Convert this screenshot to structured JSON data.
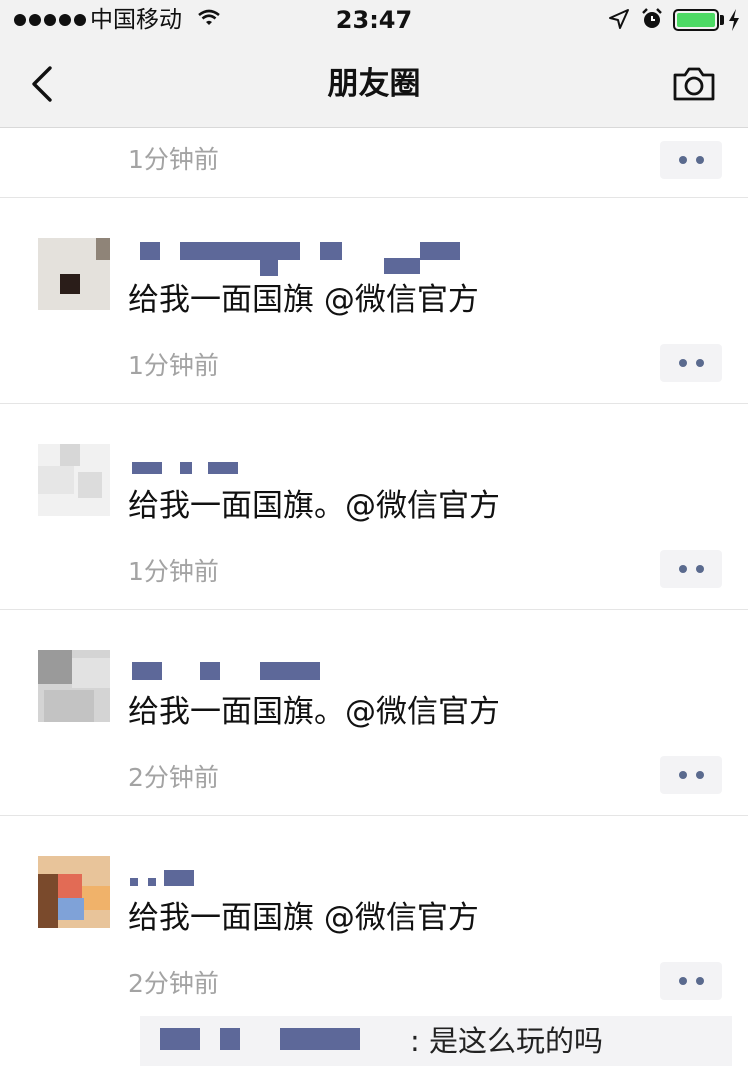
{
  "status_bar": {
    "carrier": "中国移动",
    "time": "23:47",
    "battery_level": 1.0,
    "icons": [
      "signal-dots-icon",
      "wifi-icon",
      "location-arrow-icon",
      "alarm-icon",
      "battery-icon",
      "charging-bolt-icon"
    ]
  },
  "nav": {
    "title": "朋友圈",
    "back_icon": "chevron-left-icon",
    "camera_icon": "camera-icon"
  },
  "feed": {
    "partial_row": {
      "time": "1分钟前"
    },
    "posts": [
      {
        "text": "给我一面国旗 @微信官方",
        "time": "1分钟前"
      },
      {
        "text": "给我一面国旗。@微信官方",
        "time": "1分钟前"
      },
      {
        "text": "给我一面国旗。@微信官方",
        "time": "2分钟前"
      },
      {
        "text": "给我一面国旗 @微信官方",
        "time": "2分钟前",
        "comment": ": 是这么玩的吗"
      }
    ],
    "more_icon": "more-dots-icon"
  },
  "colors": {
    "bar_bg": "#f2f2f2",
    "link_blue": "#5d6899",
    "timestamp_gray": "#a3a3a3",
    "battery_green": "#4cd964"
  }
}
